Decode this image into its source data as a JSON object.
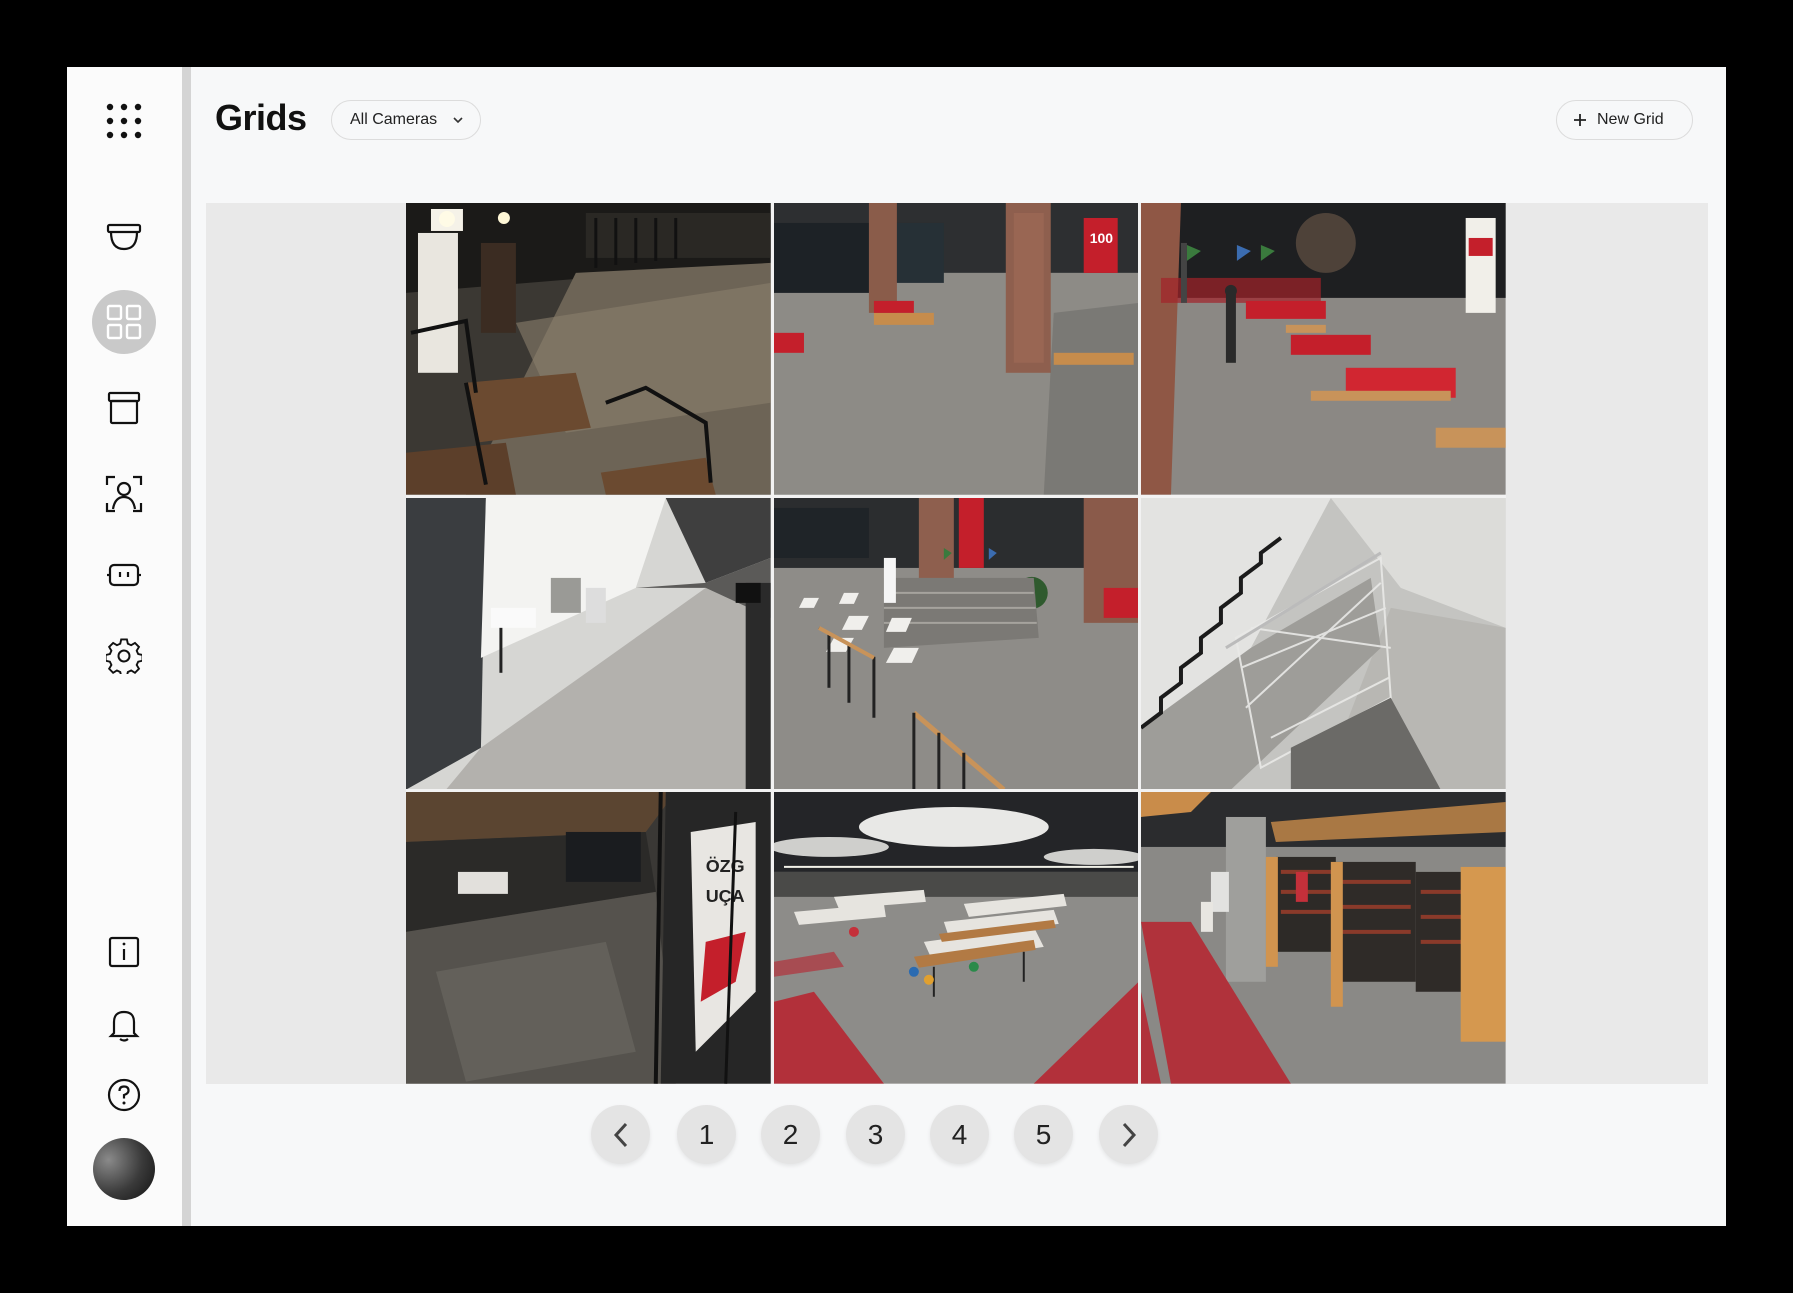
{
  "header": {
    "title": "Grids",
    "filter_label": "All Cameras",
    "new_grid_label": "New Grid"
  },
  "sidebar": {
    "top_items": [
      "apps-icon",
      "camera-dome-icon",
      "grid-icon",
      "archive-box-icon",
      "face-detect-icon",
      "device-icon",
      "gear-icon"
    ],
    "bottom_items": [
      "info-icon",
      "bell-icon",
      "help-icon",
      "avatar"
    ],
    "active": "grid-icon"
  },
  "cameras": [
    {
      "scene": "outdoor-terrace-night"
    },
    {
      "scene": "lobby-brick-pillars"
    },
    {
      "scene": "lounge-red-sofas"
    },
    {
      "scene": "white-corridor"
    },
    {
      "scene": "entrance-hall-steps"
    },
    {
      "scene": "stairwell"
    },
    {
      "scene": "dark-hallway"
    },
    {
      "scene": "study-hall-tables"
    },
    {
      "scene": "library-bookshelves"
    }
  ],
  "pagination": {
    "pages": [
      "1",
      "2",
      "3",
      "4",
      "5"
    ],
    "prev": "chevron-left-icon",
    "next": "chevron-right-icon"
  },
  "colors": {
    "accent_red": "#c8303a",
    "active_bg": "#c9c9c9",
    "page_bg": "#f7f8f9"
  }
}
